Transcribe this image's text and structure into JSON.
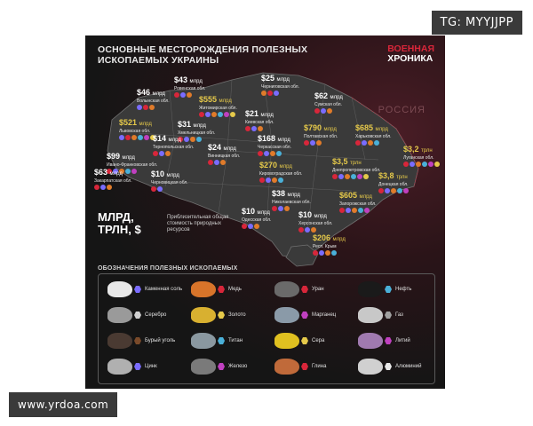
{
  "watermarks": {
    "top": "TG: MYYJJPP",
    "bottom": "www.yrdoa.com"
  },
  "poster": {
    "title_line1": "ОСНОВНЫЕ МЕСТОРОЖДЕНИЯ ПОЛЕЗНЫХ",
    "title_line2": "ИСКОПАЕМЫХ УКРАИНЫ",
    "brand_line1": "ВОЕННАЯ",
    "brand_line2": "ХРОНИКА",
    "russia_label": "РОССИЯ",
    "unit_line1": "МЛРД,",
    "unit_line2": "ТРЛН, $",
    "unit_note": "Приблизительная общая стоимость природных ресурсов",
    "legend_title": "ОБОЗНАЧЕНИЯ ПОЛЕЗНЫХ ИСКОПАЕМЫХ"
  },
  "colors": {
    "accent_red": "#d8263a",
    "gold": "#e5c94a",
    "map_fill": "#3a3a3a"
  },
  "regions": [
    {
      "value": "$43",
      "unit": "млрд",
      "name": "Ровенская обл.",
      "gold": false,
      "dots": [
        "#d8263a",
        "#7a6cff",
        "#e07b2a"
      ]
    },
    {
      "value": "$25",
      "unit": "млрд",
      "name": "Черниговская обл.",
      "gold": false,
      "dots": [
        "#e07b2a",
        "#d8263a",
        "#7a6cff"
      ]
    },
    {
      "value": "$46",
      "unit": "млрд",
      "name": "Волынская обл.",
      "gold": false,
      "dots": [
        "#7a6cff",
        "#d8263a",
        "#e07b2a"
      ]
    },
    {
      "value": "$555",
      "unit": "млрд",
      "name": "Житомирская обл.",
      "gold": true,
      "dots": [
        "#d8263a",
        "#7a6cff",
        "#e07b2a",
        "#4ab0d8",
        "#c040c0",
        "#e5c94a"
      ]
    },
    {
      "value": "$62",
      "unit": "млрд",
      "name": "Сумская обл.",
      "gold": false,
      "dots": [
        "#d8263a",
        "#7a6cff",
        "#e07b2a"
      ]
    },
    {
      "value": "$521",
      "unit": "млрд",
      "name": "Львовская обл.",
      "gold": true,
      "dots": [
        "#7a6cff",
        "#d8263a",
        "#e07b2a",
        "#4ab0d8",
        "#c040c0",
        "#e5c94a"
      ]
    },
    {
      "value": "$31",
      "unit": "млрд",
      "name": "Хмельницкая обл.",
      "gold": false,
      "dots": [
        "#d8263a",
        "#7a6cff",
        "#e07b2a",
        "#4ab0d8"
      ]
    },
    {
      "value": "$21",
      "unit": "млрд",
      "name": "Киевская обл.",
      "gold": false,
      "dots": [
        "#d8263a",
        "#7a6cff",
        "#e07b2a"
      ]
    },
    {
      "value": "$790",
      "unit": "млрд",
      "name": "Полтавская обл.",
      "gold": true,
      "dots": [
        "#d8263a",
        "#7a6cff",
        "#e07b2a"
      ]
    },
    {
      "value": "$685",
      "unit": "млрд",
      "name": "Харьковская обл.",
      "gold": true,
      "dots": [
        "#d8263a",
        "#7a6cff",
        "#e07b2a",
        "#4ab0d8"
      ]
    },
    {
      "value": "$14",
      "unit": "млрд",
      "name": "Тернопольская обл.",
      "gold": false,
      "dots": [
        "#d8263a",
        "#7a6cff",
        "#e07b2a"
      ]
    },
    {
      "value": "$24",
      "unit": "млрд",
      "name": "Винницкая обл.",
      "gold": false,
      "dots": [
        "#d8263a",
        "#7a6cff",
        "#e07b2a"
      ]
    },
    {
      "value": "$168",
      "unit": "млрд",
      "name": "Черкасская обл.",
      "gold": false,
      "dots": [
        "#d8263a",
        "#7a6cff",
        "#e07b2a",
        "#4ab0d8"
      ]
    },
    {
      "value": "$3,2",
      "unit": "трлн",
      "name": "Луганская обл.",
      "gold": true,
      "dots": [
        "#d8263a",
        "#7a6cff",
        "#e07b2a",
        "#4ab0d8",
        "#c040c0",
        "#e5c94a"
      ]
    },
    {
      "value": "$99",
      "unit": "млрд",
      "name": "Ивано-Франковская обл.",
      "gold": false,
      "dots": [
        "#d8263a",
        "#7a6cff",
        "#e07b2a",
        "#4ab0d8",
        "#c040c0"
      ]
    },
    {
      "value": "$270",
      "unit": "млрд",
      "name": "Кировоградская обл.",
      "gold": true,
      "dots": [
        "#d8263a",
        "#7a6cff",
        "#e07b2a",
        "#4ab0d8"
      ]
    },
    {
      "value": "$3,5",
      "unit": "трлн",
      "name": "Днепропетровская обл.",
      "gold": true,
      "dots": [
        "#d8263a",
        "#7a6cff",
        "#e07b2a",
        "#4ab0d8",
        "#c040c0",
        "#e5c94a"
      ]
    },
    {
      "value": "$63",
      "unit": "млрд",
      "name": "Закарпатская обл.",
      "gold": false,
      "dots": [
        "#d8263a",
        "#7a6cff",
        "#e07b2a"
      ]
    },
    {
      "value": "$10",
      "unit": "млрд",
      "name": "Черновицкая обл.",
      "gold": false,
      "dots": [
        "#d8263a",
        "#7a6cff"
      ]
    },
    {
      "value": "$3,8",
      "unit": "трлн",
      "name": "Донецкая обл.",
      "gold": true,
      "dots": [
        "#d8263a",
        "#7a6cff",
        "#e07b2a",
        "#4ab0d8",
        "#c040c0"
      ]
    },
    {
      "value": "$38",
      "unit": "млрд",
      "name": "Николаевская обл.",
      "gold": false,
      "dots": [
        "#d8263a",
        "#7a6cff",
        "#e07b2a"
      ]
    },
    {
      "value": "$605",
      "unit": "млрд",
      "name": "Запорожская обл.",
      "gold": true,
      "dots": [
        "#d8263a",
        "#7a6cff",
        "#e07b2a",
        "#4ab0d8",
        "#c040c0"
      ]
    },
    {
      "value": "$10",
      "unit": "млрд",
      "name": "Одесская обл.",
      "gold": false,
      "dots": [
        "#d8263a",
        "#7a6cff",
        "#e07b2a"
      ]
    },
    {
      "value": "$10",
      "unit": "млрд",
      "name": "Херсонская обл.",
      "gold": false,
      "dots": [
        "#d8263a",
        "#7a6cff",
        "#e07b2a"
      ]
    },
    {
      "value": "$206",
      "unit": "млрд",
      "name": "Респ. Крым",
      "gold": true,
      "dots": [
        "#d8263a",
        "#7a6cff",
        "#e07b2a",
        "#4ab0d8"
      ]
    }
  ],
  "legend": [
    {
      "label": "Каменная соль",
      "rock": "#e8e8e8",
      "hex": "#7a6cff"
    },
    {
      "label": "Медь",
      "rock": "#d8742a",
      "hex": "#d8263a"
    },
    {
      "label": "Уран",
      "rock": "#6a6a6a",
      "hex": "#d8263a"
    },
    {
      "label": "Нефть",
      "rock": "#1a1a1a",
      "hex": "#4ab0d8"
    },
    {
      "label": "Серебро",
      "rock": "#9a9a9a",
      "hex": "#d0d0d0"
    },
    {
      "label": "Золото",
      "rock": "#d8b030",
      "hex": "#e5c94a"
    },
    {
      "label": "Марганец",
      "rock": "#8a9aa8",
      "hex": "#c040c0"
    },
    {
      "label": "Газ",
      "rock": "#c8c8c8",
      "hex": "#a0a0a0"
    },
    {
      "label": "Бурый уголь",
      "rock": "#4a3a32",
      "hex": "#7a4a2a"
    },
    {
      "label": "Титан",
      "rock": "#8a98a0",
      "hex": "#4ab0d8"
    },
    {
      "label": "Сера",
      "rock": "#e0c020",
      "hex": "#e5c94a"
    },
    {
      "label": "Литий",
      "rock": "#a07ab0",
      "hex": "#c040c0"
    },
    {
      "label": "Цинк",
      "rock": "#b0b0b0",
      "hex": "#7a6cff"
    },
    {
      "label": "Железо",
      "rock": "#7a7a7a",
      "hex": "#c040c0"
    },
    {
      "label": "Глина",
      "rock": "#c06a3a",
      "hex": "#d8263a"
    },
    {
      "label": "Алюминий",
      "rock": "#d0d0d0",
      "hex": "#e8e8e8"
    }
  ]
}
